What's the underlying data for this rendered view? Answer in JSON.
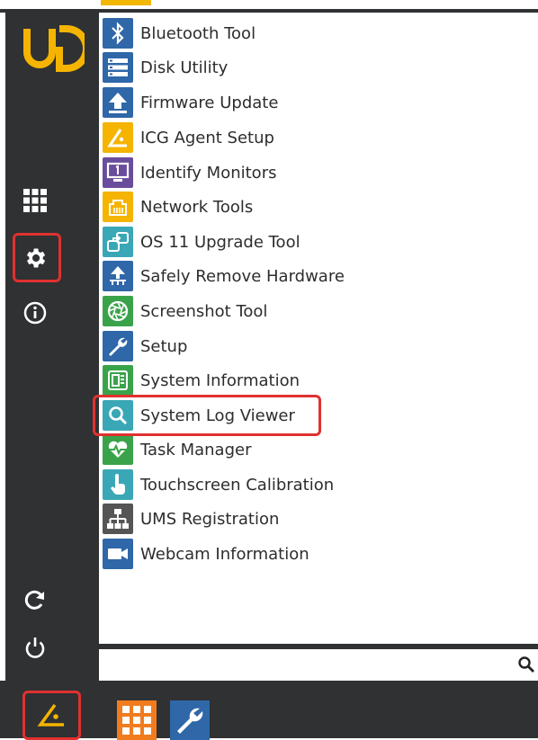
{
  "menu": {
    "items": [
      {
        "label": "Bluetooth Tool",
        "icon": "bluetooth-icon",
        "color": "#2f67a8"
      },
      {
        "label": "Disk Utility",
        "icon": "disk-icon",
        "color": "#2f67a8"
      },
      {
        "label": "Firmware Update",
        "icon": "upload-arrow-icon",
        "color": "#2f67a8"
      },
      {
        "label": "ICG Agent Setup",
        "icon": "icg-agent-icon",
        "color": "#f4b400"
      },
      {
        "label": "Identify Monitors",
        "icon": "monitor-icon",
        "color": "#6a4c9c"
      },
      {
        "label": "Network Tools",
        "icon": "network-icon",
        "color": "#f4b400"
      },
      {
        "label": "OS 11 Upgrade Tool",
        "icon": "upgrade-icon",
        "color": "#3aa7b6"
      },
      {
        "label": "Safely Remove Hardware",
        "icon": "usb-icon",
        "color": "#2f67a8"
      },
      {
        "label": "Screenshot Tool",
        "icon": "camera-shutter-icon",
        "color": "#3aa34a"
      },
      {
        "label": "Setup",
        "icon": "wrench-icon",
        "color": "#2f67a8"
      },
      {
        "label": "System Information",
        "icon": "chip-icon",
        "color": "#3aa34a"
      },
      {
        "label": "System Log Viewer",
        "icon": "magnifier-icon",
        "color": "#3aa7b6"
      },
      {
        "label": "Task Manager",
        "icon": "heartbeat-icon",
        "color": "#3aa34a"
      },
      {
        "label": "Touchscreen Calibration",
        "icon": "touch-icon",
        "color": "#3aa7b6"
      },
      {
        "label": "UMS Registration",
        "icon": "network-tree-icon",
        "color": "#555555"
      },
      {
        "label": "Webcam Information",
        "icon": "webcam-icon",
        "color": "#2f67a8"
      }
    ],
    "highlighted": "System Log Viewer"
  },
  "sidebar": {
    "logo": "UD",
    "buttons": [
      "apps-grid-icon",
      "settings-gear-icon",
      "info-icon",
      "restart-icon",
      "power-icon"
    ],
    "highlighted": "settings-gear-icon"
  },
  "search": {
    "placeholder": "",
    "icon": "search-icon"
  },
  "taskbar": {
    "start_icon": "igel-start-icon",
    "items": [
      "apps-grid-icon",
      "wrench-icon"
    ]
  },
  "colors": {
    "dark": "#2f3133",
    "accent": "#f4b400",
    "highlight": "#e0312f"
  }
}
